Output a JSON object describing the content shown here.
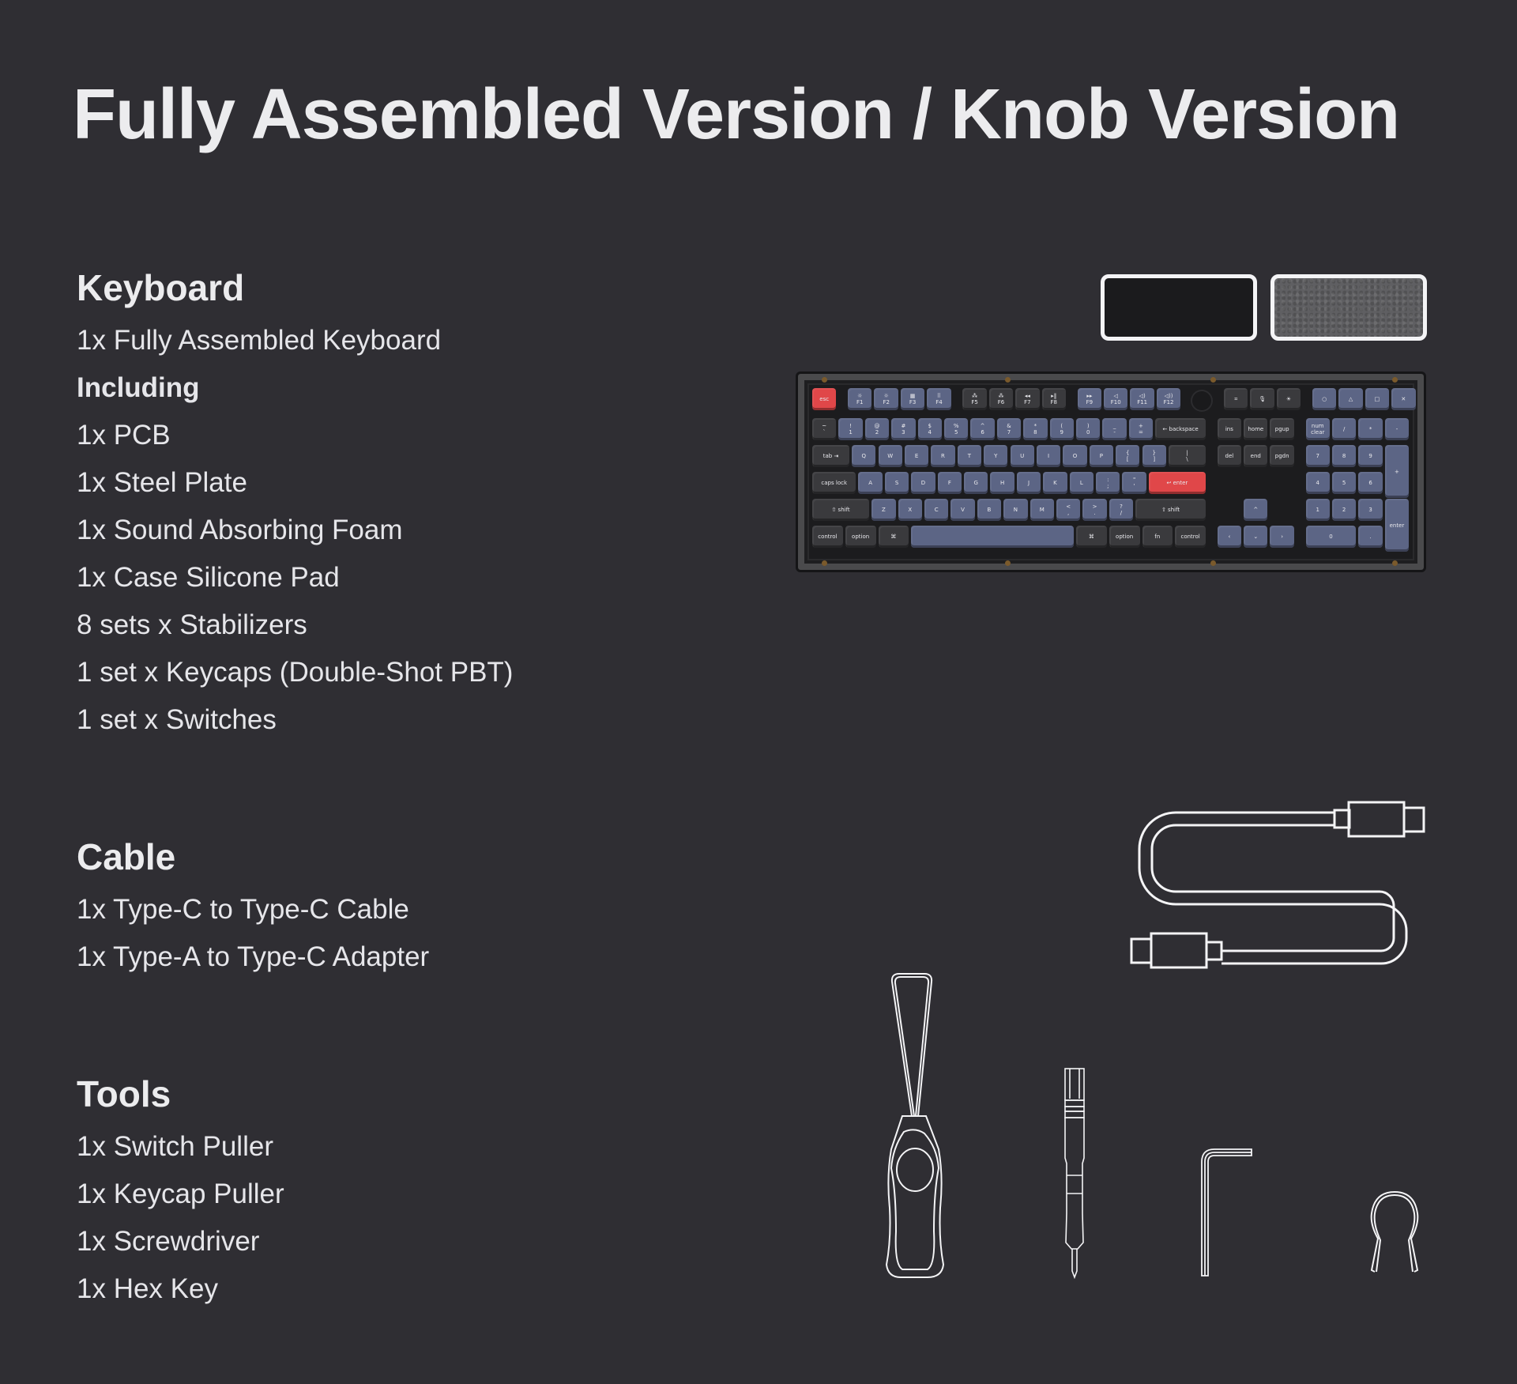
{
  "page": {
    "title": "Fully Assembled Version / Knob Version",
    "background": "#2f2e33",
    "text_color": "#ececee"
  },
  "sections": {
    "keyboard": {
      "heading": "Keyboard",
      "items": [
        {
          "text": "1x Fully Assembled Keyboard",
          "bold": false
        },
        {
          "text": "Including",
          "bold": true
        },
        {
          "text": "1x PCB",
          "bold": false
        },
        {
          "text": "1x Steel Plate",
          "bold": false
        },
        {
          "text": "1x Sound Absorbing Foam",
          "bold": false
        },
        {
          "text": "1x Case Silicone Pad",
          "bold": false
        },
        {
          "text": "8 sets x Stabilizers",
          "bold": false
        },
        {
          "text": "1 set x Keycaps (Double-Shot PBT)",
          "bold": false
        },
        {
          "text": "1 set x Switches",
          "bold": false
        }
      ]
    },
    "cable": {
      "heading": "Cable",
      "items": [
        {
          "text": "1x Type-C to Type-C Cable",
          "bold": false
        },
        {
          "text": "1x Type-A to Type-C Adapter",
          "bold": false
        }
      ]
    },
    "tools": {
      "heading": "Tools",
      "items": [
        {
          "text": "1x Switch Puller",
          "bold": false
        },
        {
          "text": "1x Keycap Puller",
          "bold": false
        },
        {
          "text": "1x Screwdriver",
          "bold": false
        },
        {
          "text": "1x Hex Key",
          "bold": false
        }
      ]
    }
  },
  "color_swatches": [
    {
      "name": "black",
      "color": "#1b1b1d"
    },
    {
      "name": "grey-felt",
      "color": "#5f5f62"
    }
  ],
  "illustrations": [
    "keyboard-image",
    "cable-icon",
    "switch-puller-icon",
    "screwdriver-icon",
    "hex-key-icon",
    "keycap-puller-icon"
  ],
  "keyboard_colors": {
    "blue": "#5c6585",
    "dark": "#3a3a3d",
    "red": "#e04749"
  },
  "keyboard_rows": [
    [
      {
        "l": "esc",
        "c": "red"
      },
      {
        "gap": 0.35
      },
      {
        "l": "☼\nF1",
        "c": "blue"
      },
      {
        "l": "☼\nF2",
        "c": "blue"
      },
      {
        "l": "▦\nF3",
        "c": "blue"
      },
      {
        "l": "⠿\nF4",
        "c": "blue"
      },
      {
        "gap": 0.35
      },
      {
        "l": "⁂\nF5",
        "c": "dark"
      },
      {
        "l": "⁂\nF6",
        "c": "dark"
      },
      {
        "l": "◂◂\nF7",
        "c": "dark"
      },
      {
        "l": "▸‖\nF8",
        "c": "dark"
      },
      {
        "gap": 0.35
      },
      {
        "l": "▸▸\nF9",
        "c": "blue"
      },
      {
        "l": "◁\nF10",
        "c": "blue"
      },
      {
        "l": "◁)\nF11",
        "c": "blue"
      },
      {
        "l": "◁))\nF12",
        "c": "blue"
      },
      {
        "gap": 0.2
      },
      {
        "knob": true
      },
      {
        "gap": 0.35
      },
      {
        "l": "⌗",
        "c": "dark"
      },
      {
        "l": "🎙",
        "c": "dark"
      },
      {
        "l": "☀",
        "c": "dark"
      },
      {
        "gap": 0.35
      },
      {
        "l": "○",
        "c": "blue"
      },
      {
        "l": "△",
        "c": "blue"
      },
      {
        "l": "□",
        "c": "blue"
      },
      {
        "l": "✕",
        "c": "blue"
      }
    ],
    [
      {
        "l": "~\n`",
        "c": "dark"
      },
      {
        "l": "!\n1",
        "c": "blue"
      },
      {
        "l": "@\n2",
        "c": "blue"
      },
      {
        "l": "#\n3",
        "c": "blue"
      },
      {
        "l": "$\n4",
        "c": "blue"
      },
      {
        "l": "%\n5",
        "c": "blue"
      },
      {
        "l": "^\n6",
        "c": "blue"
      },
      {
        "l": "&\n7",
        "c": "blue"
      },
      {
        "l": "*\n8",
        "c": "blue"
      },
      {
        "l": "(\n9",
        "c": "blue"
      },
      {
        "l": ")\n0",
        "c": "blue"
      },
      {
        "l": "_\n-",
        "c": "blue"
      },
      {
        "l": "+\n=",
        "c": "blue"
      },
      {
        "l": "← backspace",
        "c": "dark",
        "w": 2
      },
      {
        "gap": 0.35
      },
      {
        "l": "ins",
        "c": "dark"
      },
      {
        "l": "home",
        "c": "dark"
      },
      {
        "l": "pgup",
        "c": "dark"
      },
      {
        "gap": 0.35
      },
      {
        "l": "num\nclear",
        "c": "blue"
      },
      {
        "l": "/",
        "c": "blue"
      },
      {
        "l": "*",
        "c": "blue"
      },
      {
        "l": "-",
        "c": "blue"
      }
    ],
    [
      {
        "l": "tab ⇥",
        "c": "dark",
        "w": 1.5
      },
      {
        "l": "Q",
        "c": "blue"
      },
      {
        "l": "W",
        "c": "blue"
      },
      {
        "l": "E",
        "c": "blue"
      },
      {
        "l": "R",
        "c": "blue"
      },
      {
        "l": "T",
        "c": "blue"
      },
      {
        "l": "Y",
        "c": "blue"
      },
      {
        "l": "U",
        "c": "blue"
      },
      {
        "l": "I",
        "c": "blue"
      },
      {
        "l": "O",
        "c": "blue"
      },
      {
        "l": "P",
        "c": "blue"
      },
      {
        "l": "{\n[",
        "c": "blue"
      },
      {
        "l": "}\n]",
        "c": "blue"
      },
      {
        "l": "|\n\\",
        "c": "dark",
        "w": 1.5
      },
      {
        "gap": 0.35
      },
      {
        "l": "del",
        "c": "dark"
      },
      {
        "l": "end",
        "c": "dark"
      },
      {
        "l": "pgdn",
        "c": "dark"
      },
      {
        "gap": 0.35
      },
      {
        "l": "7",
        "c": "blue"
      },
      {
        "l": "8",
        "c": "blue"
      },
      {
        "l": "9",
        "c": "blue"
      },
      {
        "l": "+",
        "c": "blue",
        "h": 2
      }
    ],
    [
      {
        "l": "caps lock",
        "c": "dark",
        "w": 1.75
      },
      {
        "l": "A",
        "c": "blue"
      },
      {
        "l": "S",
        "c": "blue"
      },
      {
        "l": "D",
        "c": "blue"
      },
      {
        "l": "F",
        "c": "blue"
      },
      {
        "l": "G",
        "c": "blue"
      },
      {
        "l": "H",
        "c": "blue"
      },
      {
        "l": "J",
        "c": "blue"
      },
      {
        "l": "K",
        "c": "blue"
      },
      {
        "l": "L",
        "c": "blue"
      },
      {
        "l": ":\n;",
        "c": "blue"
      },
      {
        "l": "\"\n'",
        "c": "blue"
      },
      {
        "l": "↩ enter",
        "c": "red",
        "w": 2.25
      },
      {
        "gap": 3.7
      },
      {
        "l": "4",
        "c": "blue"
      },
      {
        "l": "5",
        "c": "blue"
      },
      {
        "l": "6",
        "c": "blue"
      }
    ],
    [
      {
        "l": "⇧ shift",
        "c": "dark",
        "w": 2.25
      },
      {
        "l": "Z",
        "c": "blue"
      },
      {
        "l": "X",
        "c": "blue"
      },
      {
        "l": "C",
        "c": "blue"
      },
      {
        "l": "V",
        "c": "blue"
      },
      {
        "l": "B",
        "c": "blue"
      },
      {
        "l": "N",
        "c": "blue"
      },
      {
        "l": "M",
        "c": "blue"
      },
      {
        "l": "<\n,",
        "c": "blue"
      },
      {
        "l": ">\n.",
        "c": "blue"
      },
      {
        "l": "?\n/",
        "c": "blue"
      },
      {
        "l": "⇧ shift",
        "c": "dark",
        "w": 2.75
      },
      {
        "gap": 1.35
      },
      {
        "l": "^",
        "c": "blue"
      },
      {
        "gap": 1.35
      },
      {
        "l": "1",
        "c": "blue"
      },
      {
        "l": "2",
        "c": "blue"
      },
      {
        "l": "3",
        "c": "blue"
      },
      {
        "l": "enter",
        "c": "blue",
        "h": 2
      }
    ],
    [
      {
        "l": "control",
        "c": "dark",
        "w": 1.25
      },
      {
        "l": "option",
        "c": "dark",
        "w": 1.25
      },
      {
        "l": "⌘",
        "c": "dark",
        "w": 1.25
      },
      {
        "l": "",
        "c": "blue",
        "w": 6.25
      },
      {
        "l": "⌘",
        "c": "dark",
        "w": 1.25
      },
      {
        "l": "option",
        "c": "dark",
        "w": 1.25
      },
      {
        "l": "fn",
        "c": "dark",
        "w": 1.25
      },
      {
        "l": "control",
        "c": "dark",
        "w": 1.25
      },
      {
        "gap": 0.35
      },
      {
        "l": "‹",
        "c": "blue"
      },
      {
        "l": "⌄",
        "c": "blue"
      },
      {
        "l": "›",
        "c": "blue"
      },
      {
        "gap": 0.35
      },
      {
        "l": "0",
        "c": "blue",
        "w": 2
      },
      {
        "l": ".",
        "c": "blue"
      }
    ]
  ]
}
